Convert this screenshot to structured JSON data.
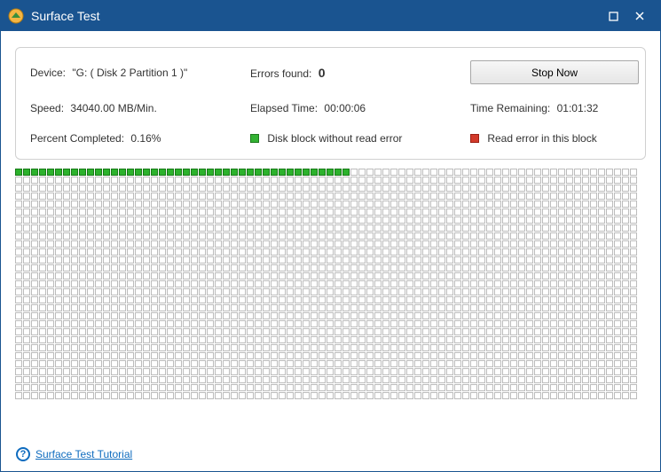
{
  "window": {
    "title": "Surface Test"
  },
  "info": {
    "device_label": "Device:",
    "device_value": "\"G: ( Disk 2 Partition 1 )\"",
    "errors_label": "Errors found:",
    "errors_value": "0",
    "stop_label": "Stop Now",
    "speed_label": "Speed:",
    "speed_value": "34040.00 MB/Min.",
    "elapsed_label": "Elapsed Time:",
    "elapsed_value": "00:00:06",
    "remaining_label": "Time Remaining:",
    "remaining_value": "01:01:32",
    "percent_label": "Percent Completed:",
    "percent_value": "0.16%",
    "legend_ok": "Disk block without read error",
    "legend_err": "Read error in this block"
  },
  "grid": {
    "cols": 78,
    "rows": 29,
    "completed_blocks": 42
  },
  "footer": {
    "tutorial_text": "Surface Test Tutorial"
  }
}
